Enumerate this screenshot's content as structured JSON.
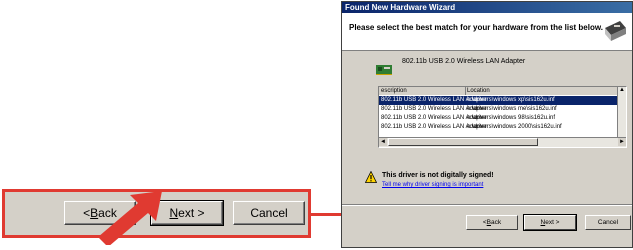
{
  "zoom": {
    "back_prefix": "< ",
    "back_accel": "B",
    "back_rest": "ack",
    "next_accel": "N",
    "next_rest": "ext >",
    "cancel": "Cancel"
  },
  "colors": {
    "accent_red": "#e03a31",
    "titlebar": "#0a246a",
    "dialog_bg": "#d4d0c8",
    "selection": "#0a246a",
    "link": "#0000ee"
  },
  "window": {
    "title": "Found New Hardware Wizard",
    "header": "Please select the best match for your hardware from the list below.",
    "device_name": "802.11b USB 2.0 Wireless LAN Adapter",
    "columns": [
      "escription",
      "Location"
    ],
    "rows": [
      {
        "description": "802.11b USB 2.0 Wireless LAN Adapter",
        "location": "e:\\drivers\\windows xp\\sis162u.inf"
      },
      {
        "description": "802.11b USB 2.0 Wireless LAN Adapter",
        "location": "e:\\drivers\\windows me\\sis162u.inf"
      },
      {
        "description": "802.11b USB 2.0 Wireless LAN Adapter",
        "location": "e:\\drivers\\windows 98\\sis162u.inf"
      },
      {
        "description": "802.11b USB 2.0 Wireless LAN Adapter",
        "location": "e:\\drivers\\windows 2000\\sis162u.inf"
      }
    ],
    "selected_row_index": 0,
    "warning_title": "This driver is not digitally signed!",
    "warning_link": "Tell me why driver signing is important",
    "buttons": {
      "back_prefix": "< ",
      "back_accel": "B",
      "back_rest": "ack",
      "next_accel": "N",
      "next_rest": "ext >",
      "cancel": "Cancel"
    }
  }
}
